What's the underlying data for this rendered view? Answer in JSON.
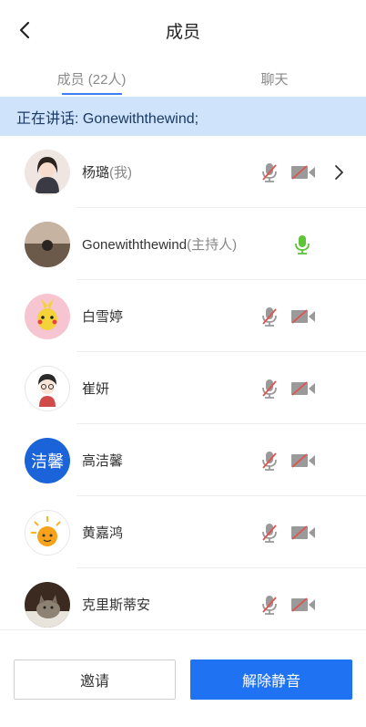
{
  "header": {
    "title": "成员"
  },
  "tabs": [
    {
      "label": "成员 (22人)"
    },
    {
      "label": "聊天"
    }
  ],
  "speaking": {
    "text": "正在讲话: Gonewiththewind;"
  },
  "members": [
    {
      "name": "杨璐",
      "role": "(我)"
    },
    {
      "name": "Gonewiththewind",
      "role": "(主持人)"
    },
    {
      "name": "白雪婷",
      "role": ""
    },
    {
      "name": "崔妍",
      "role": ""
    },
    {
      "name": "高洁馨",
      "role": "",
      "avatar_text": "洁馨"
    },
    {
      "name": "黄嘉鸿",
      "role": ""
    },
    {
      "name": "克里斯蒂安",
      "role": ""
    }
  ],
  "footer": {
    "invite_label": "邀请",
    "unmute_label": "解除静音"
  },
  "colors": {
    "accent": "#1f73f2",
    "speaking_bg": "#cfe3fb",
    "mic_on": "#5ec53a",
    "icon_muted": "#9a9a9a",
    "slash": "#e0524f"
  }
}
